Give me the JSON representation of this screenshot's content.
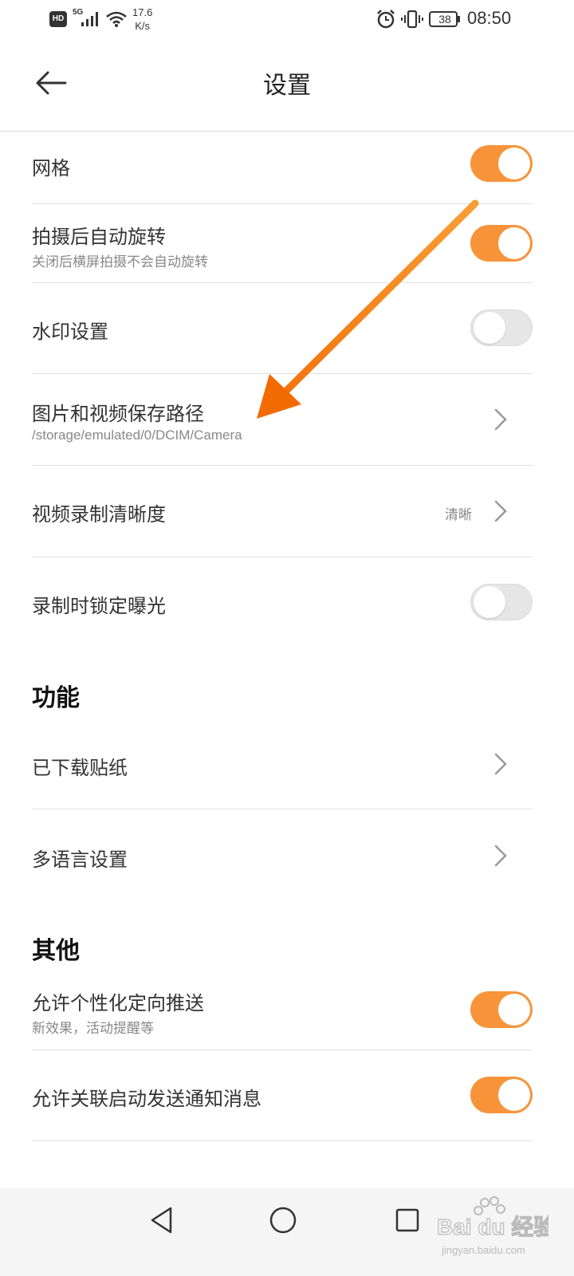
{
  "status_bar": {
    "hd": "HD",
    "network": "5G",
    "speed_value": "17.6",
    "speed_unit": "K/s",
    "battery": "38",
    "time": "08:50"
  },
  "header": {
    "title": "设置"
  },
  "settings": [
    {
      "title": "网格",
      "toggle": true
    },
    {
      "title": "拍摄后自动旋转",
      "subtitle": "关闭后横屏拍摄不会自动旋转",
      "toggle": true
    },
    {
      "title": "水印设置",
      "toggle": false
    },
    {
      "title": "图片和视频保存路径",
      "subtitle": "/storage/emulated/0/DCIM/Camera"
    },
    {
      "title": "视频录制清晰度",
      "value": "清晰"
    },
    {
      "title": "录制时锁定曝光",
      "toggle": false
    }
  ],
  "sections": {
    "features": {
      "title": "功能",
      "items": [
        {
          "title": "已下载贴纸"
        },
        {
          "title": "多语言设置"
        }
      ]
    },
    "other": {
      "title": "其他",
      "items": [
        {
          "title": "允许个性化定向推送",
          "subtitle": "新效果，活动提醒等",
          "toggle": true
        },
        {
          "title": "允许关联启动发送通知消息",
          "toggle": true
        }
      ]
    }
  },
  "colors": {
    "accent": "#f7943a",
    "annotation_arrow": "#f7931e",
    "toggle_off": "#e6e6e6"
  },
  "icons": {
    "back": "arrow-left-icon",
    "chevron": "chevron-right-icon",
    "nav_back": "triangle-back-icon",
    "nav_home": "circle-home-icon",
    "nav_recent": "square-recent-icon"
  },
  "watermark": {
    "brand": "Bai du 经验",
    "url": "jingyan.baidu.com"
  }
}
